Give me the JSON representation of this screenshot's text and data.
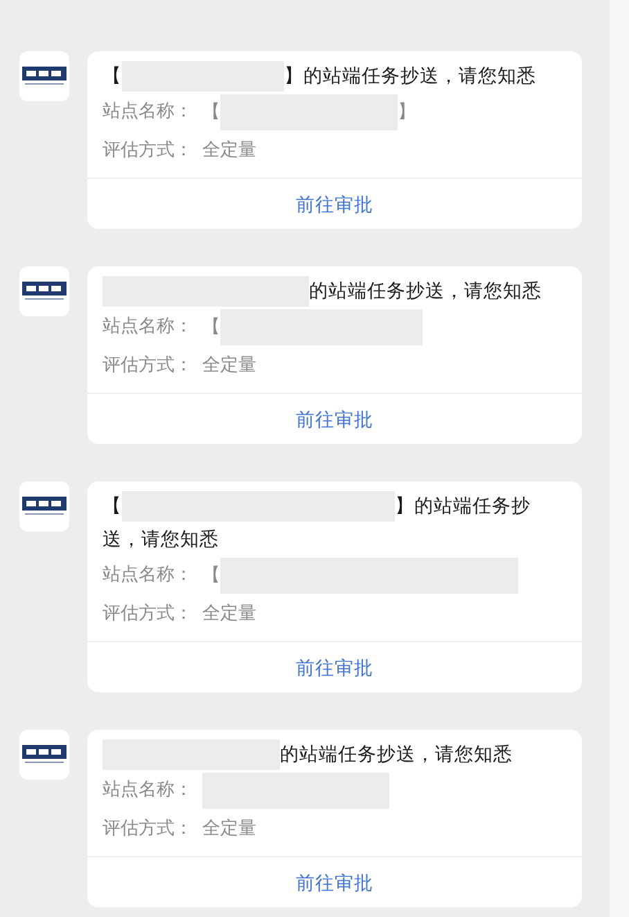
{
  "messages": [
    {
      "title": [
        {
          "kind": "text",
          "text": "【"
        },
        {
          "kind": "redacted"
        },
        {
          "kind": "text",
          "text": "】的站端任务抄送，请您知悉"
        }
      ],
      "fields": [
        {
          "label": "站点名称：",
          "value": [
            {
              "kind": "text",
              "text": "【"
            },
            {
              "kind": "redacted"
            },
            {
              "kind": "text",
              "text": "】"
            }
          ]
        },
        {
          "label": "评估方式：",
          "value": [
            {
              "kind": "text",
              "text": "全定量"
            }
          ]
        }
      ],
      "action": "前往审批"
    },
    {
      "title": [
        {
          "kind": "redacted"
        },
        {
          "kind": "text",
          "text": "的站端任务抄送，请您知悉"
        }
      ],
      "fields": [
        {
          "label": "站点名称：",
          "value": [
            {
              "kind": "text",
              "text": "【"
            },
            {
              "kind": "redacted"
            }
          ]
        },
        {
          "label": "评估方式：",
          "value": [
            {
              "kind": "text",
              "text": "全定量"
            }
          ]
        }
      ],
      "action": "前往审批"
    },
    {
      "title": [
        {
          "kind": "text",
          "text": "【"
        },
        {
          "kind": "redacted"
        },
        {
          "kind": "text",
          "text": "】的站端任务抄"
        },
        {
          "kind": "text",
          "text": "送，请您知悉"
        }
      ],
      "fields": [
        {
          "label": "站点名称：",
          "value": [
            {
              "kind": "text",
              "text": "【"
            },
            {
              "kind": "redacted"
            }
          ]
        },
        {
          "label": "评估方式：",
          "value": [
            {
              "kind": "text",
              "text": "全定量"
            }
          ]
        }
      ],
      "action": "前往审批"
    },
    {
      "title": [
        {
          "kind": "redacted"
        },
        {
          "kind": "text",
          "text": "的站端任务抄送，请您知悉"
        }
      ],
      "fields": [
        {
          "label": "站点名称：",
          "value": [
            {
              "kind": "redacted"
            }
          ]
        },
        {
          "label": "评估方式：",
          "value": [
            {
              "kind": "text",
              "text": "全定量"
            }
          ]
        }
      ],
      "action": "前往审批"
    }
  ]
}
